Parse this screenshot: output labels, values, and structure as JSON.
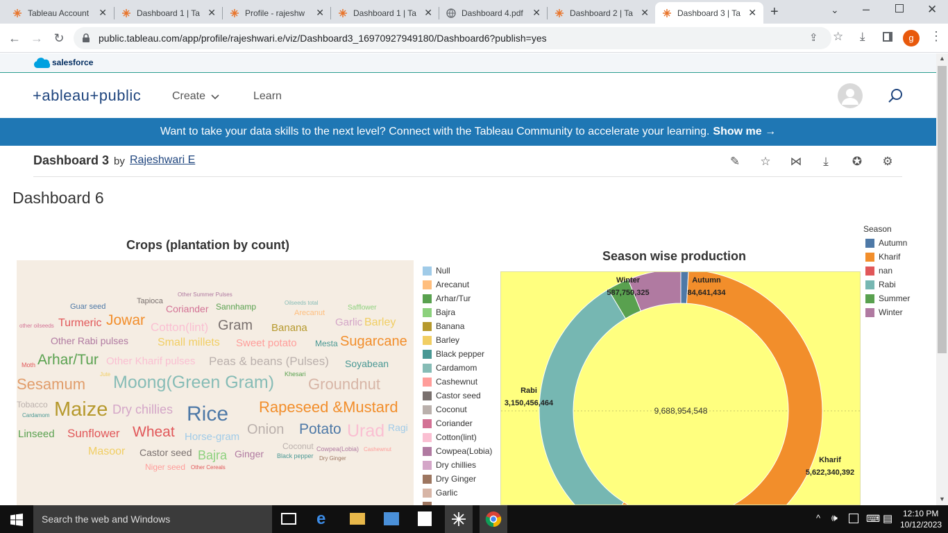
{
  "browser": {
    "tabs": [
      {
        "title": "Tableau Account"
      },
      {
        "title": "Dashboard 1 | Ta"
      },
      {
        "title": "Profile - rajeshw"
      },
      {
        "title": "Dashboard 1 | Ta"
      },
      {
        "title": "Dashboard 4.pdf"
      },
      {
        "title": "Dashboard 2 | Ta"
      },
      {
        "title": "Dashboard 3 | Ta"
      }
    ],
    "url": "public.tableau.com/app/profile/rajeshwari.e/viz/Dashboard3_16970927949180/Dashboard6?publish=yes",
    "profile_initial": "g"
  },
  "site": {
    "salesforce_label": "salesforce",
    "logo_text": "+ableau+public",
    "nav": {
      "create": "Create",
      "learn": "Learn"
    },
    "banner_text": "Want to take your data skills to the next level? Connect with the Tableau Community to accelerate your learning.",
    "banner_link": "Show me →"
  },
  "viz": {
    "title": "Dashboard 3",
    "by": "by",
    "author": "Rajeshwari E",
    "dashboard_title": "Dashboard 6"
  },
  "wordcloud": {
    "title": "Crops (plantation by count)",
    "words": [
      {
        "t": "Other Summer Pulses",
        "c": "#b07aa1"
      },
      {
        "t": "Tapioca",
        "c": "#79706e"
      },
      {
        "t": "Guar seed",
        "c": "#4e79a7"
      },
      {
        "t": "Coriander",
        "c": "#d37295"
      },
      {
        "t": "Sannhamp",
        "c": "#59a14f"
      },
      {
        "t": "Oilseeds total",
        "c": "#86bcb6"
      },
      {
        "t": "Safflower",
        "c": "#8cd17d"
      },
      {
        "t": "Arecanut",
        "c": "#ffbe7d"
      },
      {
        "t": "other oilseeds",
        "c": "#d37295"
      },
      {
        "t": "Turmeric",
        "c": "#e15759"
      },
      {
        "t": "Jowar",
        "c": "#f28e2b"
      },
      {
        "t": "Cotton(lint)",
        "c": "#fabfd2"
      },
      {
        "t": "Gram",
        "c": "#79706e"
      },
      {
        "t": "Banana",
        "c": "#b6992d"
      },
      {
        "t": "Garlic",
        "c": "#d4a6c8"
      },
      {
        "t": "Barley",
        "c": "#f1ce63"
      },
      {
        "t": "Other Rabi pulses",
        "c": "#b07aa1"
      },
      {
        "t": "Small millets",
        "c": "#f1ce63"
      },
      {
        "t": "Sweet potato",
        "c": "#ff9d9a"
      },
      {
        "t": "Mesta",
        "c": "#499894"
      },
      {
        "t": "Sugarcane",
        "c": "#f28e2b"
      },
      {
        "t": "Moth",
        "c": "#e15759"
      },
      {
        "t": "Arhar/Tur",
        "c": "#59a14f"
      },
      {
        "t": "Other Kharif pulses",
        "c": "#fabfd2"
      },
      {
        "t": "Peas & beans (Pulses)",
        "c": "#bab0ac"
      },
      {
        "t": "Soyabean",
        "c": "#499894"
      },
      {
        "t": "Jute",
        "c": "#f1ce63"
      },
      {
        "t": "Khesari",
        "c": "#59a14f"
      },
      {
        "t": "Sesamum",
        "c": "#e19d6b"
      },
      {
        "t": "Moong(Green Gram)",
        "c": "#86bcb6"
      },
      {
        "t": "Groundnut",
        "c": "#d7b5a6"
      },
      {
        "t": "Tobacco",
        "c": "#bab0ac"
      },
      {
        "t": "Cardamom",
        "c": "#499894"
      },
      {
        "t": "Maize",
        "c": "#b6992d"
      },
      {
        "t": "Dry chillies",
        "c": "#d4a6c8"
      },
      {
        "t": "Rice",
        "c": "#4e79a7"
      },
      {
        "t": "Rapeseed &Mustard",
        "c": "#f28e2b"
      },
      {
        "t": "Linseed",
        "c": "#59a14f"
      },
      {
        "t": "Sunflower",
        "c": "#e15759"
      },
      {
        "t": "Wheat",
        "c": "#e15759"
      },
      {
        "t": "Horse-gram",
        "c": "#a0cbe8"
      },
      {
        "t": "Onion",
        "c": "#bab0ac"
      },
      {
        "t": "Potato",
        "c": "#4e79a7"
      },
      {
        "t": "Urad",
        "c": "#fabfd2"
      },
      {
        "t": "Ragi",
        "c": "#a0cbe8"
      },
      {
        "t": "Coconut",
        "c": "#bab0ac"
      },
      {
        "t": "Masoor",
        "c": "#f1ce63"
      },
      {
        "t": "Castor seed",
        "c": "#79706e"
      },
      {
        "t": "Bajra",
        "c": "#8cd17d"
      },
      {
        "t": "Ginger",
        "c": "#b07aa1"
      },
      {
        "t": "Black pepper",
        "c": "#499894"
      },
      {
        "t": "Cowpea(Lobia)",
        "c": "#b07aa1"
      },
      {
        "t": "Dry Ginger",
        "c": "#9d7660"
      },
      {
        "t": "Cashewnut",
        "c": "#ff9d9a"
      },
      {
        "t": "Niger seed",
        "c": "#ff9d9a"
      },
      {
        "t": "Other Cereals",
        "c": "#e15759"
      }
    ]
  },
  "crop_legend": [
    {
      "label": "Null",
      "color": "#a0cbe8"
    },
    {
      "label": "Arecanut",
      "color": "#ffbe7d"
    },
    {
      "label": "Arhar/Tur",
      "color": "#59a14f"
    },
    {
      "label": "Bajra",
      "color": "#8cd17d"
    },
    {
      "label": "Banana",
      "color": "#b6992d"
    },
    {
      "label": "Barley",
      "color": "#f1ce63"
    },
    {
      "label": "Black pepper",
      "color": "#499894"
    },
    {
      "label": "Cardamom",
      "color": "#86bcb6"
    },
    {
      "label": "Cashewnut",
      "color": "#ff9d9a"
    },
    {
      "label": "Castor seed",
      "color": "#79706e"
    },
    {
      "label": "Coconut",
      "color": "#bab0ac"
    },
    {
      "label": "Coriander",
      "color": "#d37295"
    },
    {
      "label": "Cotton(lint)",
      "color": "#fabfd2"
    },
    {
      "label": "Cowpea(Lobia)",
      "color": "#b07aa1"
    },
    {
      "label": "Dry chillies",
      "color": "#d4a6c8"
    },
    {
      "label": "Dry Ginger",
      "color": "#9d7660"
    },
    {
      "label": "Garlic",
      "color": "#d7b5a6"
    }
  ],
  "chart_data": {
    "type": "pie",
    "title": "Season wise production",
    "total_label": "9,688,954,548",
    "legend_title": "Season",
    "legend": [
      {
        "label": "Autumn",
        "color": "#4e79a7"
      },
      {
        "label": "Kharif",
        "color": "#f28e2b"
      },
      {
        "label": "nan",
        "color": "#e15759"
      },
      {
        "label": "Rabi",
        "color": "#76b7b2"
      },
      {
        "label": "Summer",
        "color": "#59a14f"
      },
      {
        "label": "Winter",
        "color": "#b07aa1"
      }
    ],
    "slices": [
      {
        "name": "Autumn",
        "value": 84641434,
        "label": "84,641,434",
        "color": "#4e79a7"
      },
      {
        "name": "Kharif",
        "value": 5622340392,
        "label": "5,622,340,392",
        "color": "#f28e2b"
      },
      {
        "name": "nan",
        "value": 0,
        "label": "",
        "color": "#e15759"
      },
      {
        "name": "Rabi",
        "value": 3150456464,
        "label": "3,150,456,464",
        "color": "#76b7b2"
      },
      {
        "name": "Summer",
        "value": 243766233,
        "label": "",
        "color": "#59a14f"
      },
      {
        "name": "Winter",
        "value": 587750325,
        "label": "587,750,325",
        "color": "#b07aa1"
      }
    ]
  },
  "taskbar": {
    "search_placeholder": "Search the web and Windows",
    "time": "12:10 PM",
    "date": "10/12/2023"
  }
}
